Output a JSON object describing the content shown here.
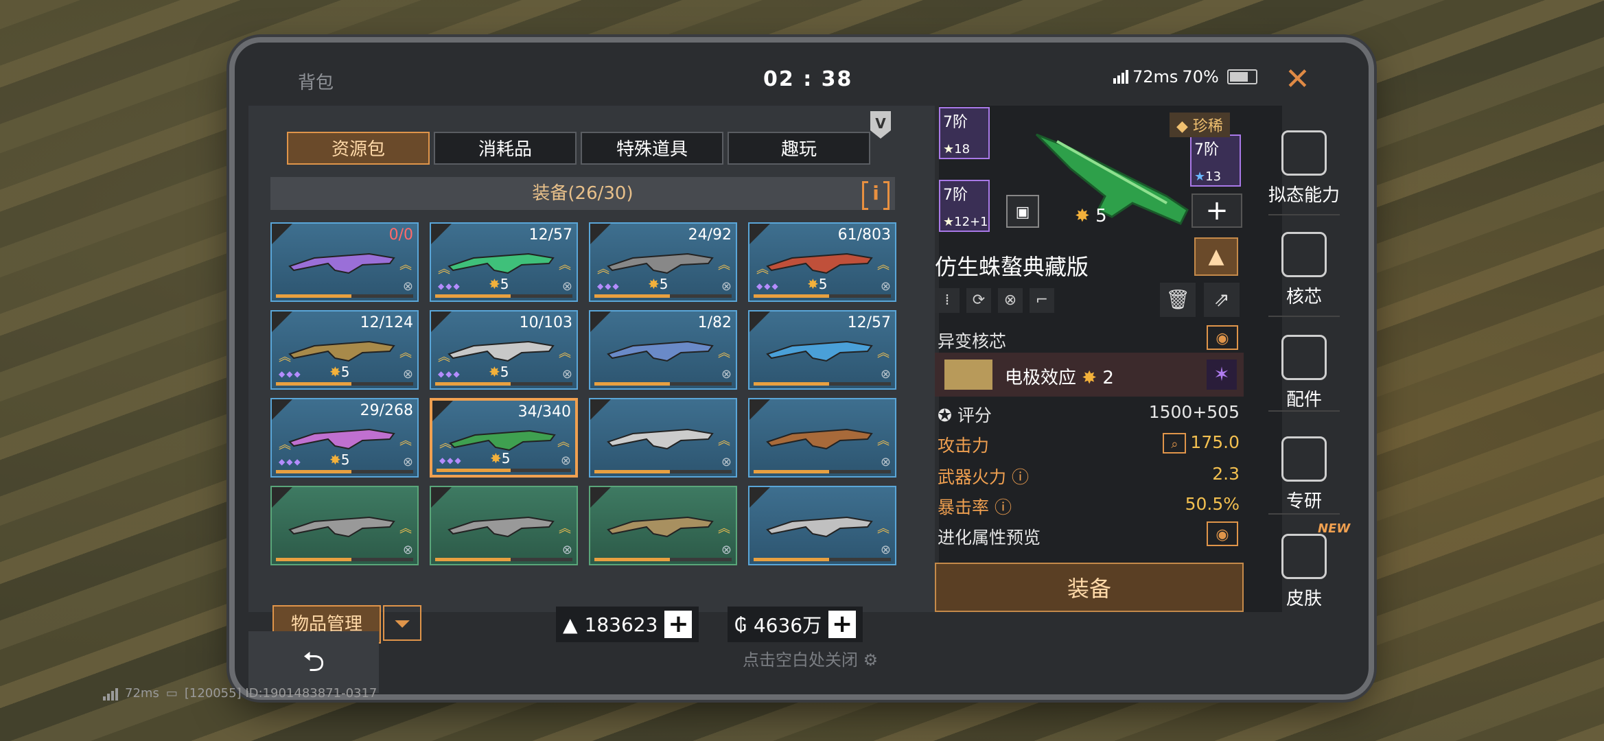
{
  "header": {
    "title": "背包",
    "time": "02 : 38",
    "ping": "72ms",
    "battery": "70%"
  },
  "tabs": [
    "资源包",
    "消耗品",
    "特殊道具",
    "趣玩"
  ],
  "section": {
    "title": "装备(26/30)"
  },
  "items": [
    {
      "count": "0/0",
      "red": true,
      "stars": "",
      "color": "#9a6fd8"
    },
    {
      "count": "12/57",
      "stars": "5",
      "color": "#3fc07a"
    },
    {
      "count": "24/92",
      "stars": "5",
      "color": "#888"
    },
    {
      "count": "61/803",
      "stars": "5",
      "color": "#c0503a"
    },
    {
      "count": "12/124",
      "stars": "5",
      "color": "#a88a4a"
    },
    {
      "count": "10/103",
      "stars": "5",
      "color": "#c8c8c8"
    },
    {
      "count": "1/82",
      "stars": "",
      "color": "#6a8ac8"
    },
    {
      "count": "12/57",
      "stars": "",
      "color": "#4aa0d8"
    },
    {
      "count": "29/268",
      "stars": "5",
      "color": "#c070d0"
    },
    {
      "count": "34/340",
      "stars": "5",
      "color": "#3fa050",
      "selected": true
    },
    {
      "count": "",
      "stars": "",
      "color": "#ccc"
    },
    {
      "count": "",
      "stars": "",
      "color": "#a86a3a"
    },
    {
      "count": "",
      "stars": "",
      "color": "#999",
      "green": true
    },
    {
      "count": "",
      "stars": "",
      "color": "#999",
      "green": true
    },
    {
      "count": "",
      "stars": "",
      "color": "#a89060",
      "green": true
    },
    {
      "count": "",
      "stars": "",
      "color": "#c0c0c0"
    }
  ],
  "bottom": {
    "manage": "物品管理",
    "currency1": "183623",
    "currency2": "4636万",
    "close_hint": "点击空白处关闭"
  },
  "detail": {
    "rarity": "珍稀",
    "tier_label": "7阶",
    "tier1_stars": "18",
    "tier2_stars": "13",
    "tier3_stars": "12+1",
    "weapon_stars": "5",
    "weapon_name": "仿生蛛螯典藏版",
    "mutation_core": "异变核芯",
    "core_name": "电极效应",
    "core_level": "2",
    "score_label": "评分",
    "score_value": "1500+505",
    "attack_label": "攻击力",
    "attack_value": "175.0",
    "fire_label": "武器火力",
    "fire_value": "2.3",
    "crit_label": "暴击率",
    "crit_value": "50.5%",
    "evo_label": "进化属性预览",
    "equip": "装备"
  },
  "side_nav": [
    "拟态能力",
    "核芯",
    "配件",
    "专研",
    "皮肤"
  ],
  "side_nav_badge": "NEW",
  "debug": {
    "ping": "72ms",
    "id": "[120055] ID:1901483871-0317"
  },
  "colors": {
    "accent": "#e0954a",
    "frame": "#5aa6d8"
  }
}
